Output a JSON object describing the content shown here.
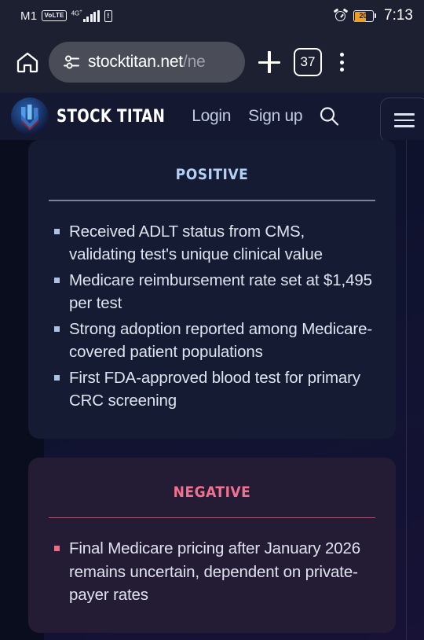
{
  "status_bar": {
    "carrier": "M1",
    "volte_badge": "VoLTE",
    "network_type": "4G",
    "network_superscript": "+",
    "sim_icon": "sim-card-icon",
    "alarm_icon": "alarm-clock-icon",
    "battery_percent": "20",
    "battery_color": "#f0a020",
    "time": "7:13"
  },
  "browser": {
    "home_icon": "home-icon",
    "site_settings_icon": "tune-icon",
    "url_visible": "stocktitan.net",
    "url_dim_suffix": "/ne",
    "new_tab_icon": "plus-icon",
    "tab_count": "37",
    "menu_icon": "kebab-menu-icon"
  },
  "site_header": {
    "logo_icon": "stock-titan-logo-icon",
    "brand": "STOCK TITAN",
    "login_label": "Login",
    "signup_label": "Sign up",
    "search_icon": "search-icon",
    "hamburger_icon": "hamburger-menu-icon"
  },
  "content": {
    "positive": {
      "title": "Positive",
      "accent_color": "#b3d0f5",
      "bullets": [
        "Received ADLT status from CMS, validating test's unique clinical value",
        "Medicare reimbursement rate set at $1,495 per test",
        "Strong adoption reported among Medicare-covered patient populations",
        "First FDA-approved blood test for primary CRC screening"
      ]
    },
    "negative": {
      "title": "Negative",
      "accent_color": "#f4708f",
      "bullets": [
        "Final Medicare pricing after January 2026 remains uncertain, dependent on private-payer rates"
      ]
    }
  }
}
